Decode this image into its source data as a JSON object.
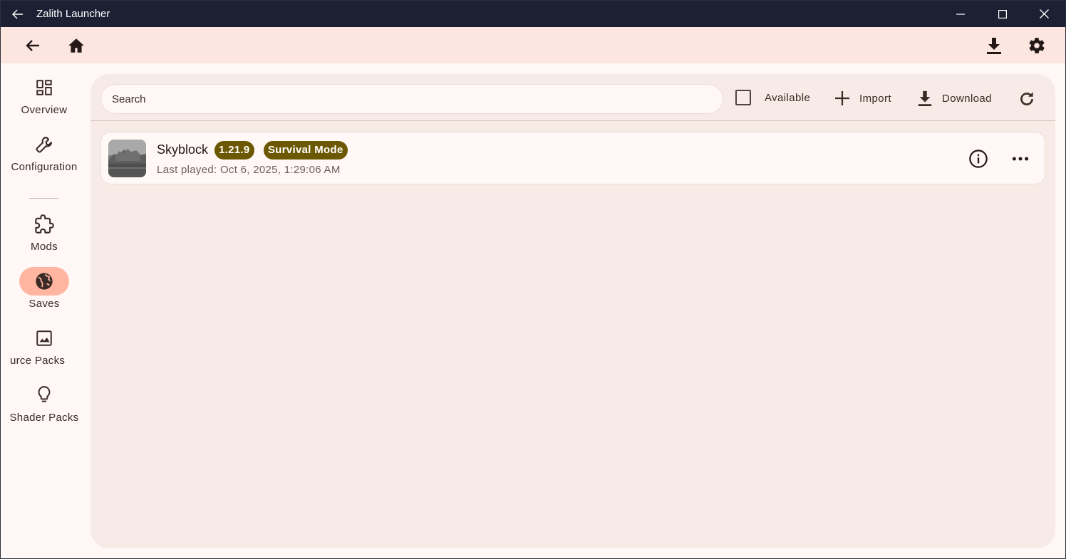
{
  "window": {
    "title": "Zalith Launcher",
    "controls": [
      "minimize",
      "maximize",
      "close"
    ]
  },
  "appbar": {
    "left_icons": [
      "arrow-back-icon",
      "home-icon"
    ],
    "right_icons": [
      "download-icon",
      "settings-icon"
    ]
  },
  "sidebar": {
    "items": [
      {
        "label": "Overview",
        "icon": "dashboard-icon",
        "active": false
      },
      {
        "label": "Configuration",
        "icon": "wrench-icon",
        "active": false
      },
      {
        "label": "Mods",
        "icon": "puzzle-icon",
        "active": false
      },
      {
        "label": "Saves",
        "icon": "globe-icon",
        "active": true
      },
      {
        "label": "Resource Packs",
        "visible_label": "urce Packs",
        "icon": "image-icon",
        "active": false
      },
      {
        "label": "Shader Packs",
        "icon": "lightbulb-icon",
        "active": false
      }
    ]
  },
  "toolbar": {
    "search_placeholder": "Search",
    "available_label": "Available",
    "available_checked": false,
    "import_label": "Import",
    "download_label": "Download"
  },
  "saves": [
    {
      "name": "Skyblock",
      "version": "1.21.9",
      "mode": "Survival Mode",
      "last_played": "Last played: Oct 6, 2025, 1:29:06 AM"
    }
  ],
  "colors": {
    "titlebar_bg": "#1b2033",
    "appbar_bg": "#fde6df",
    "panel_bg": "#f7ebe7",
    "active_pill": "#ffb59f",
    "badge_bg": "#6b5800",
    "text": "#3a2a26"
  }
}
